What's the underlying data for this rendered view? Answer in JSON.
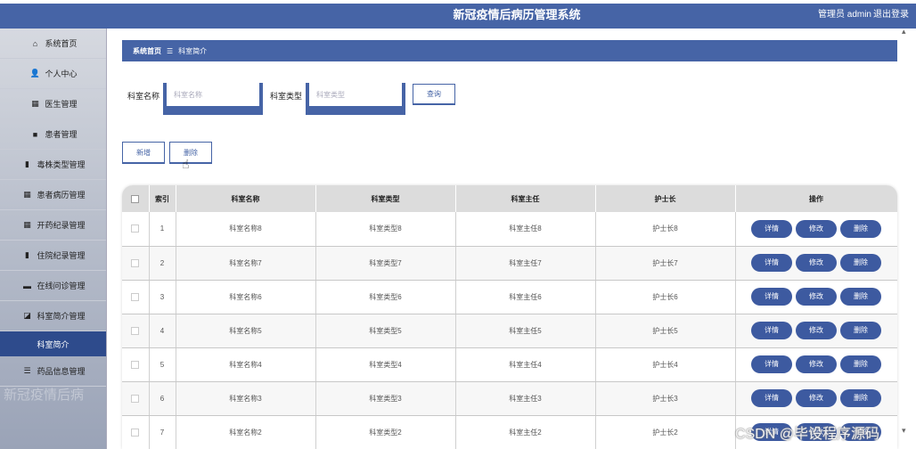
{
  "header": {
    "title": "新冠疫情后病历管理系统",
    "user": "管理员 admin",
    "logout": "退出登录"
  },
  "sidebar": {
    "items": [
      {
        "label": "系统首页",
        "icon": "home-icon",
        "glyph": "⌂"
      },
      {
        "label": "个人中心",
        "icon": "user-icon",
        "glyph": "👤"
      },
      {
        "label": "医生管理",
        "icon": "grid-icon",
        "glyph": "▦"
      },
      {
        "label": "患者管理",
        "icon": "users-icon",
        "glyph": "■"
      },
      {
        "label": "毒株类型管理",
        "icon": "book-icon",
        "glyph": "▮"
      },
      {
        "label": "患者病历管理",
        "icon": "grid-icon",
        "glyph": "▦"
      },
      {
        "label": "开药纪录管理",
        "icon": "grid-icon",
        "glyph": "▦"
      },
      {
        "label": "住院纪录管理",
        "icon": "bar-chart-icon",
        "glyph": "▮"
      },
      {
        "label": "在线问诊管理",
        "icon": "chat-icon",
        "glyph": "▬"
      },
      {
        "label": "科室简介管理",
        "icon": "chart-icon",
        "glyph": "◪"
      }
    ],
    "active_sub": "科室简介",
    "last_item": {
      "label": "药品信息管理",
      "icon": "list-icon",
      "glyph": "☰"
    },
    "watermark": "新冠疫情后病"
  },
  "breadcrumb": {
    "home": "系统首页",
    "sep": "☰",
    "current": "科室简介"
  },
  "search": {
    "name_label": "科室名称",
    "name_placeholder": "科室名称",
    "type_label": "科室类型",
    "type_placeholder": "科室类型",
    "query_label": "查询"
  },
  "actions": {
    "add_label": "新增",
    "delete_label": "删除"
  },
  "table": {
    "headers": [
      "索引",
      "科室名称",
      "科室类型",
      "科室主任",
      "护士长",
      "操作"
    ],
    "op_labels": {
      "detail": "详情",
      "edit": "修改",
      "delete": "删除"
    },
    "rows": [
      {
        "index": "1",
        "name": "科室名称8",
        "type": "科室类型8",
        "director": "科室主任8",
        "head_nurse": "护士长8"
      },
      {
        "index": "2",
        "name": "科室名称7",
        "type": "科室类型7",
        "director": "科室主任7",
        "head_nurse": "护士长7"
      },
      {
        "index": "3",
        "name": "科室名称6",
        "type": "科室类型6",
        "director": "科室主任6",
        "head_nurse": "护士长6"
      },
      {
        "index": "4",
        "name": "科室名称5",
        "type": "科室类型5",
        "director": "科室主任5",
        "head_nurse": "护士长5"
      },
      {
        "index": "5",
        "name": "科室名称4",
        "type": "科室类型4",
        "director": "科室主任4",
        "head_nurse": "护士长4"
      },
      {
        "index": "6",
        "name": "科室名称3",
        "type": "科室类型3",
        "director": "科室主任3",
        "head_nurse": "护士长3"
      },
      {
        "index": "7",
        "name": "科室名称2",
        "type": "科室类型2",
        "director": "科室主任2",
        "head_nurse": "护士长2"
      }
    ]
  },
  "watermark": "CSDN @毕设程序源码",
  "colors": {
    "primary": "#4664a6",
    "button": "#3d5aa0",
    "active_nav": "#2e4b8c"
  }
}
